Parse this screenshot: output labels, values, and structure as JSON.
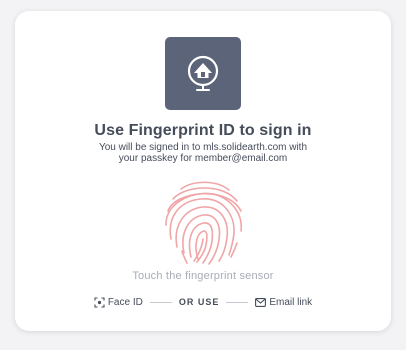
{
  "title": "Use Fingerprint ID to sign in",
  "subtitle": {
    "line1": "You will be signed in to mls.solidearth.com with",
    "line2": "your passkey for member@email.com"
  },
  "hint": "Touch the fingerprint sensor",
  "options": {
    "face_id_label": "Face ID",
    "or_use_label": "OR USE",
    "email_link_label": "Email link"
  },
  "icons": {
    "logo": "globe-house-icon",
    "fingerprint": "fingerprint-icon",
    "face_id": "face-id-icon",
    "email": "mail-icon"
  },
  "colors": {
    "logo_bg": "#5b6478",
    "fingerprint": "#f0a5a7",
    "text": "#454c5a",
    "hint": "#a8adb6"
  }
}
